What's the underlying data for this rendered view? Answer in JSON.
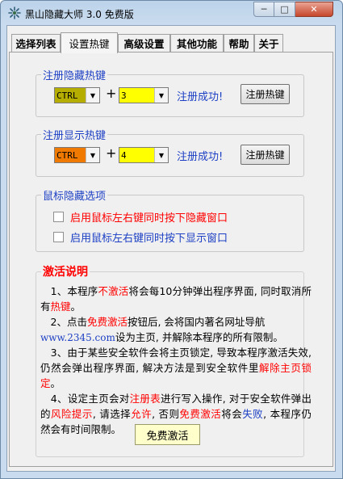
{
  "window": {
    "title": "黑山隐藏大师 3.0 免费版",
    "controls": {
      "minimize": "─",
      "maximize": "□",
      "close": "✕"
    }
  },
  "tabs": [
    {
      "label": "选择列表",
      "active": false
    },
    {
      "label": "设置热键",
      "active": true
    },
    {
      "label": "高级设置",
      "active": false
    },
    {
      "label": "其他功能",
      "active": false
    },
    {
      "label": "帮助",
      "active": false
    },
    {
      "label": "关于",
      "active": false
    }
  ],
  "hide_hotkey": {
    "legend": "注册隐藏热键",
    "modifier": "CTRL",
    "key": "3",
    "plus": "+",
    "status": "注册成功!",
    "button": "注册热键",
    "colors": {
      "modifier_bg": "#b5ad00",
      "key_bg": "#ffff00"
    }
  },
  "show_hotkey": {
    "legend": "注册显示热键",
    "modifier": "CTRL",
    "key": "4",
    "plus": "+",
    "status": "注册成功!",
    "button": "注册热键",
    "colors": {
      "modifier_bg": "#f07a00",
      "key_bg": "#ffff00"
    }
  },
  "mouse_hide": {
    "legend": "鼠标隐藏选项",
    "options": [
      {
        "label": "启用鼠标左右键同时按下隐藏窗口",
        "checked": false,
        "color": "#ff0000"
      },
      {
        "label": "启用鼠标左右键同时按下显示窗口",
        "checked": false,
        "color": "#1c3fc4"
      }
    ]
  },
  "activation": {
    "legend": "激活说明",
    "p1": [
      "　1、本程序",
      "不激活",
      "将会每10分钟弹出程序界面, 同时取消所有",
      "热键",
      "。"
    ],
    "p2": [
      "　2、点击",
      "免费激活",
      "按钮后, 会将国内著名网址导航",
      "www.2345.com",
      "设为主页, 并解除本程序的所有限制。"
    ],
    "p3": [
      "　3、由于某些安全软件会将主页锁定, 导致本程序激活失效, 仍然会弹出程序界面, 解决方法是到安全软件里",
      "解除主页锁定",
      "。"
    ],
    "p4": [
      "　4、设定主页会对",
      "注册表",
      "进行写入操作, 对于安全软件弹出的",
      "风险提示",
      ", 请选择",
      "允许",
      ", 否则",
      "免费激活",
      "将会",
      "失败",
      ", 本程序仍然会有时间限制。"
    ],
    "button": "免费激活"
  }
}
